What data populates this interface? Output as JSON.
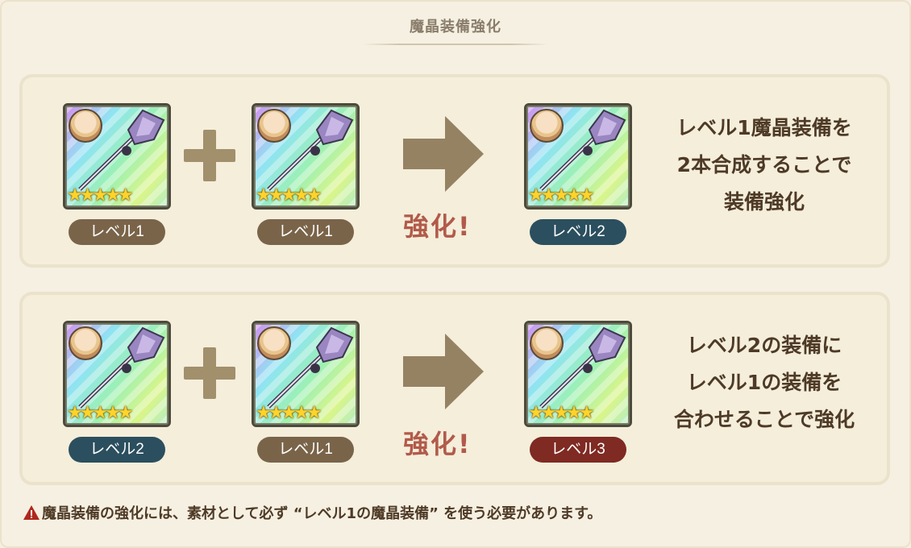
{
  "header": {
    "title": "魔晶装備強化"
  },
  "panels": [
    {
      "cards": [
        {
          "level_label": "レベル1",
          "pill_color": "#7a6449",
          "stars": "★★★★★"
        },
        {
          "level_label": "レベル1",
          "pill_color": "#7a6449",
          "stars": "★★★★★"
        },
        {
          "level_label": "レベル2",
          "pill_color": "#2b4f5e",
          "stars": "★★★★★"
        }
      ],
      "boost_label": "強化!",
      "description": [
        "レベル1魔晶装備を",
        "2本合成することで",
        "装備強化"
      ]
    },
    {
      "cards": [
        {
          "level_label": "レベル2",
          "pill_color": "#2b4f5e",
          "stars": "★★★★★"
        },
        {
          "level_label": "レベル1",
          "pill_color": "#7a6449",
          "stars": "★★★★★"
        },
        {
          "level_label": "レベル3",
          "pill_color": "#7f2a22",
          "stars": "★★★★★"
        }
      ],
      "boost_label": "強化!",
      "description": [
        "レベル2の装備に",
        "レベル1の装備を",
        "合わせることで強化"
      ]
    }
  ],
  "note": {
    "icon": "warning-icon",
    "text": "魔晶装備の強化には、素材として必ず “レベル1の魔晶装備” を使う必要があります。"
  },
  "colors": {
    "background": "#f5efe0",
    "plus": "#a28f6c",
    "arrow": "#958262",
    "boost_text": "#b25a4a",
    "warning": "#b0281c"
  }
}
